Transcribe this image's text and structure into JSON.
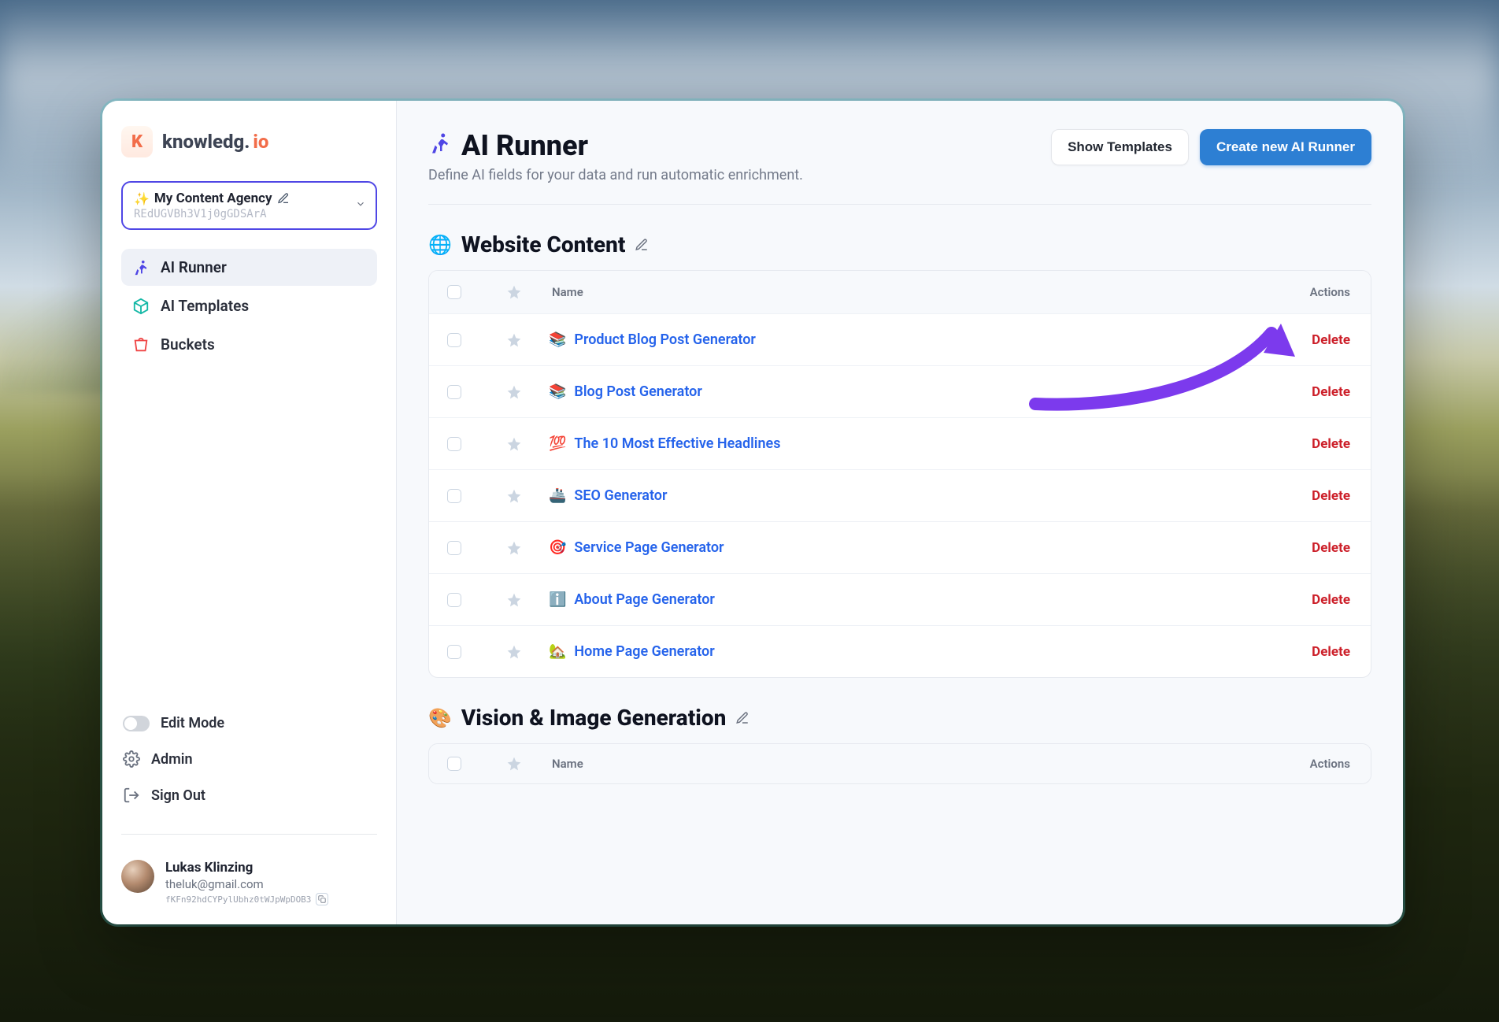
{
  "brand": {
    "name_dark": "knowledg.",
    "name_accent": "io"
  },
  "workspace": {
    "emoji": "✨",
    "name": "My Content Agency",
    "id": "REdUGVBh3V1j0gGDSArA"
  },
  "sidebar": {
    "items": [
      {
        "label": "AI Runner",
        "active": true
      },
      {
        "label": "AI Templates",
        "active": false
      },
      {
        "label": "Buckets",
        "active": false
      }
    ],
    "edit_mode_label": "Edit Mode",
    "admin_label": "Admin",
    "signout_label": "Sign Out"
  },
  "user": {
    "name": "Lukas Klinzing",
    "email": "theluk@gmail.com",
    "id": "fKFn92hdCYPylUbhz0tWJpWpDOB3"
  },
  "page": {
    "title": "AI Runner",
    "subtitle": "Define AI fields for your data and run automatic enrichment.",
    "btn_show_templates": "Show Templates",
    "btn_create": "Create new AI Runner"
  },
  "table_headers": {
    "name": "Name",
    "actions": "Actions"
  },
  "delete_label": "Delete",
  "sections": [
    {
      "emoji": "🌐",
      "title": "Website Content",
      "rows": [
        {
          "emoji": "📚",
          "name": "Product Blog Post Generator"
        },
        {
          "emoji": "📚",
          "name": "Blog Post Generator"
        },
        {
          "emoji": "💯",
          "name": "The 10 Most Effective Headlines"
        },
        {
          "emoji": "🚢",
          "name": "SEO Generator"
        },
        {
          "emoji": "🎯",
          "name": "Service Page Generator"
        },
        {
          "emoji": "ℹ️",
          "name": "About Page Generator"
        },
        {
          "emoji": "🏡",
          "name": "Home Page Generator"
        }
      ]
    },
    {
      "emoji": "🎨",
      "title": "Vision & Image Generation",
      "rows": []
    }
  ]
}
